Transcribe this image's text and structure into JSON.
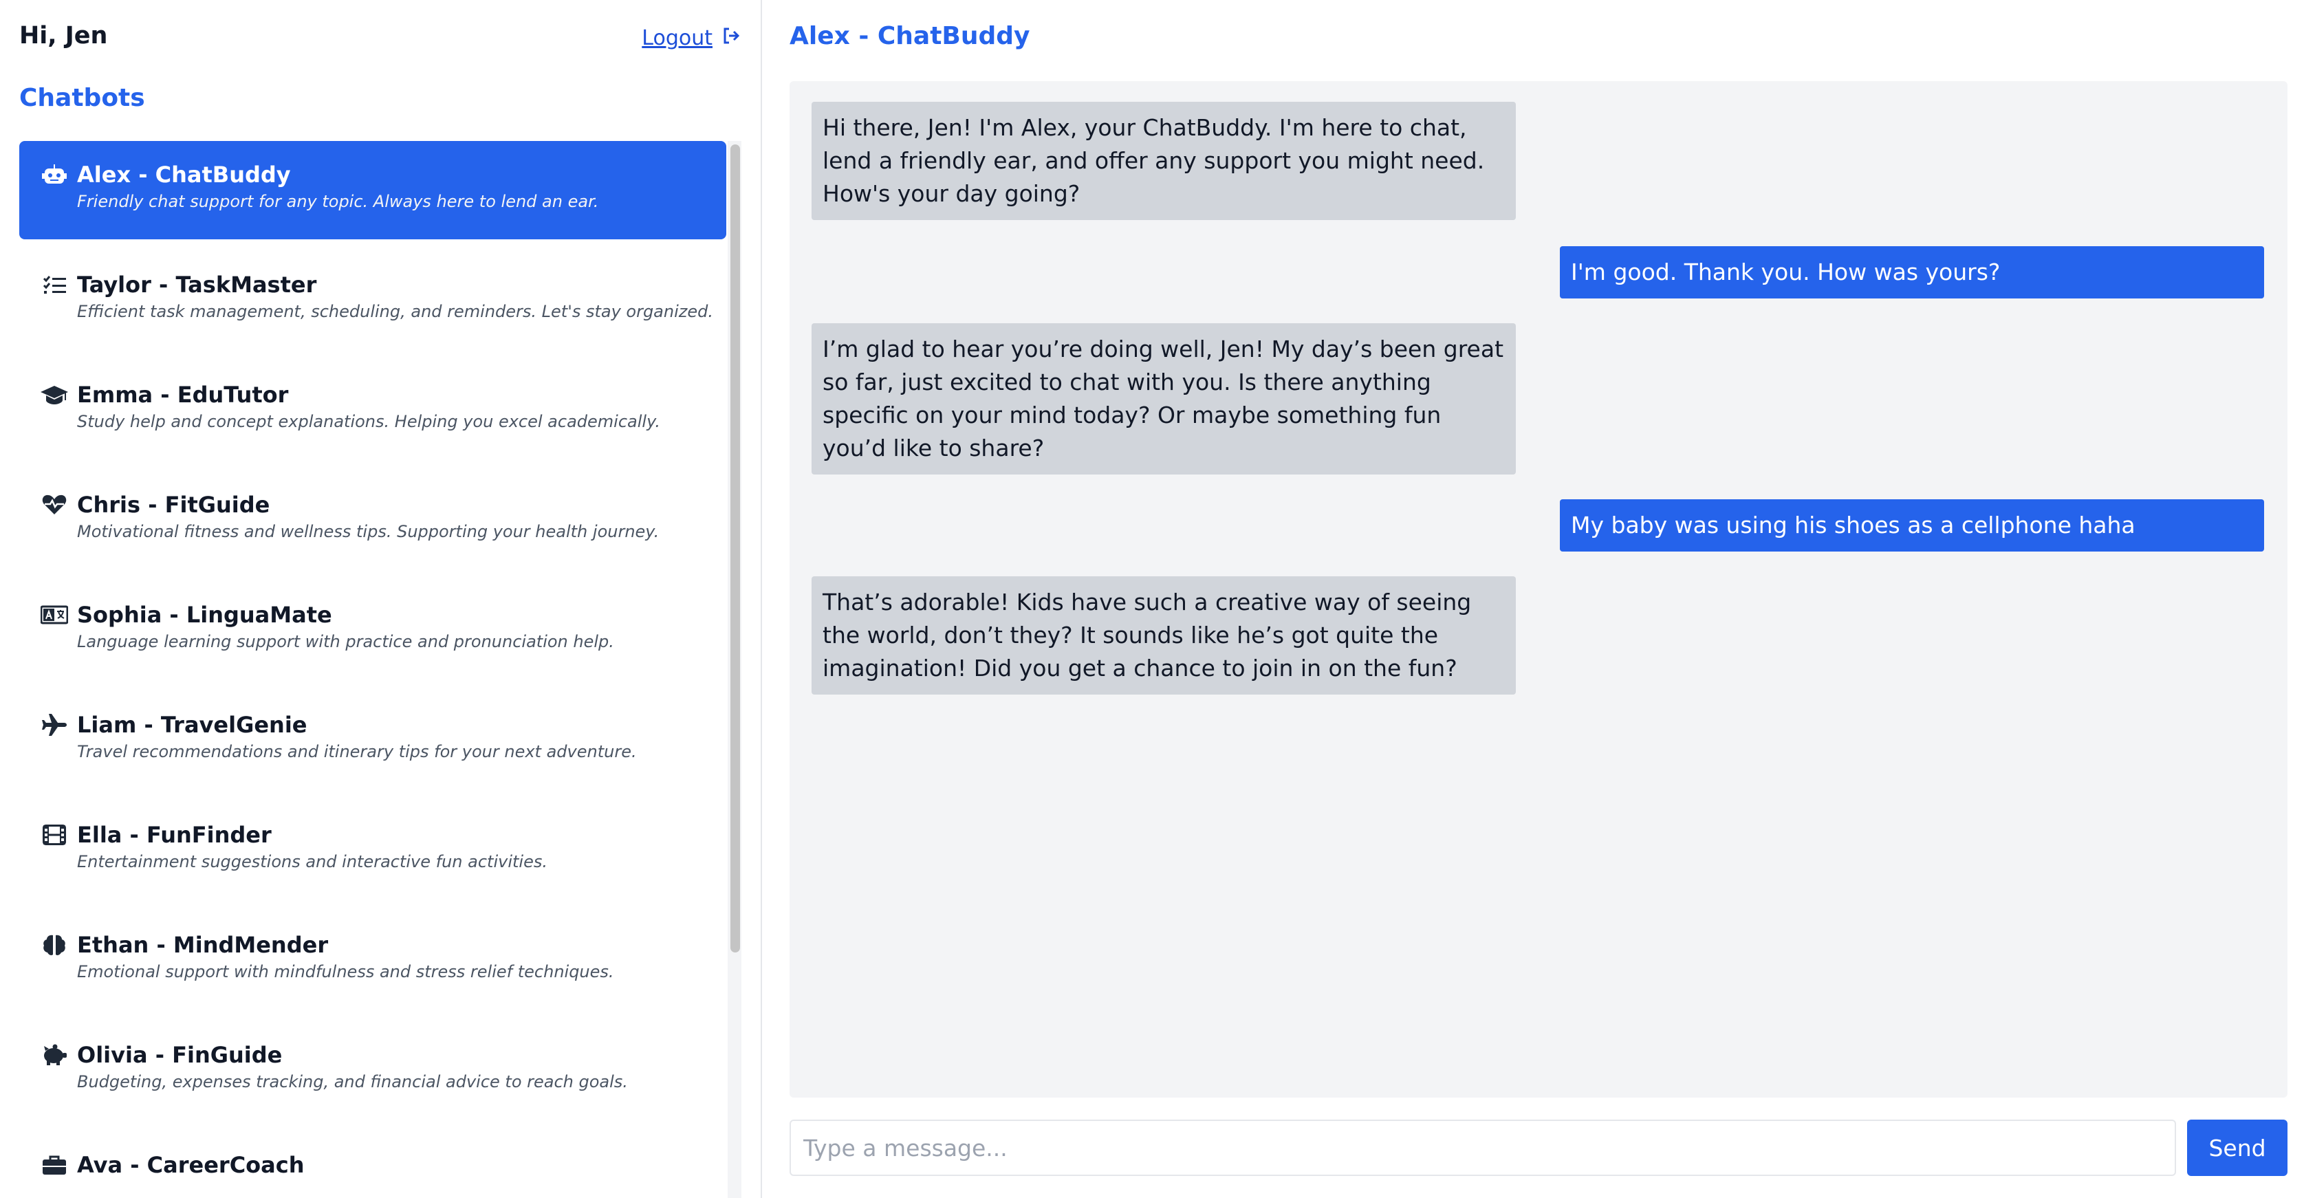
{
  "sidebar": {
    "greeting": "Hi, Jen",
    "logout_label": "Logout",
    "title": "Chatbots",
    "bots": [
      {
        "name": "Alex - ChatBuddy",
        "desc": "Friendly chat support for any topic. Always here to lend an ear.",
        "icon": "robot-icon"
      },
      {
        "name": "Taylor - TaskMaster",
        "desc": "Efficient task management, scheduling, and reminders. Let's stay organized.",
        "icon": "list-check-icon"
      },
      {
        "name": "Emma - EduTutor",
        "desc": "Study help and concept explanations. Helping you excel academically.",
        "icon": "graduation-cap-icon"
      },
      {
        "name": "Chris - FitGuide",
        "desc": "Motivational fitness and wellness tips. Supporting your health journey.",
        "icon": "heart-pulse-icon"
      },
      {
        "name": "Sophia - LinguaMate",
        "desc": "Language learning support with practice and pronunciation help.",
        "icon": "language-icon"
      },
      {
        "name": "Liam - TravelGenie",
        "desc": "Travel recommendations and itinerary tips for your next adventure.",
        "icon": "plane-icon"
      },
      {
        "name": "Ella - FunFinder",
        "desc": "Entertainment suggestions and interactive fun activities.",
        "icon": "film-icon"
      },
      {
        "name": "Ethan - MindMender",
        "desc": "Emotional support with mindfulness and stress relief techniques.",
        "icon": "brain-icon"
      },
      {
        "name": "Olivia - FinGuide",
        "desc": "Budgeting, expenses tracking, and financial advice to reach goals.",
        "icon": "piggy-bank-icon"
      },
      {
        "name": "Ava - CareerCoach",
        "desc": "",
        "icon": "briefcase-icon"
      }
    ]
  },
  "chat": {
    "title": "Alex - ChatBuddy",
    "messages": [
      {
        "from": "bot",
        "text": "Hi there, Jen! I'm Alex, your ChatBuddy. I'm here to chat, lend a friendly ear, and offer any support you might need. How's your day going?"
      },
      {
        "from": "user",
        "text": "I'm good. Thank you. How was yours?"
      },
      {
        "from": "bot",
        "text": "I’m glad to hear you’re doing well, Jen! My day’s been great so far, just excited to chat with you. Is there anything specific on your mind today? Or maybe something fun you’d like to share?"
      },
      {
        "from": "user",
        "text": "My baby was using his shoes as a cellphone haha"
      },
      {
        "from": "bot",
        "text": "That’s adorable! Kids have such a creative way of seeing the world, don’t they? It sounds like he’s got quite the imagination! Did you get a chance to join in on the fun?"
      }
    ],
    "input_placeholder": "Type a message...",
    "input_value": "",
    "send_label": "Send"
  },
  "colors": {
    "accent": "#2563eb",
    "bot_bubble": "#d1d5db",
    "chat_bg": "#f3f4f6"
  }
}
